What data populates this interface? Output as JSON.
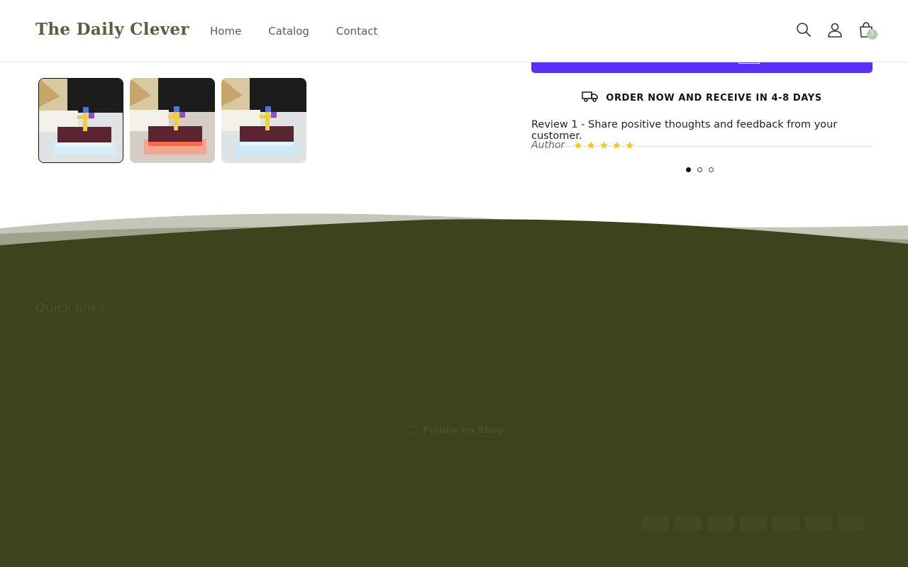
{
  "header": {
    "logo": "The Daily Clever",
    "nav": [
      {
        "label": "Home"
      },
      {
        "label": "Catalog"
      },
      {
        "label": "Contact"
      }
    ],
    "icons": [
      "search-icon",
      "account-icon",
      "cart-icon"
    ],
    "cart_count": "1"
  },
  "product": {
    "shipping_text": "ORDER NOW AND RECEIVE IN 4-8 DAYS",
    "review_text": "Review 1 - Share positive thoughts and feedback from your customer.",
    "review_author": "Author",
    "review_rating": 5,
    "review_stars": "★ ★ ★ ★ ★",
    "carousel_total": 3,
    "carousel_active": 1
  },
  "footer": {
    "quick_links": "Quick links",
    "follow_label": "Follow on Shop"
  },
  "colors": {
    "brand_text": "#5b5f3c",
    "footer_bg": "#3d441d",
    "shop_pay": "#5a31f4",
    "star": "#f6c31a"
  }
}
